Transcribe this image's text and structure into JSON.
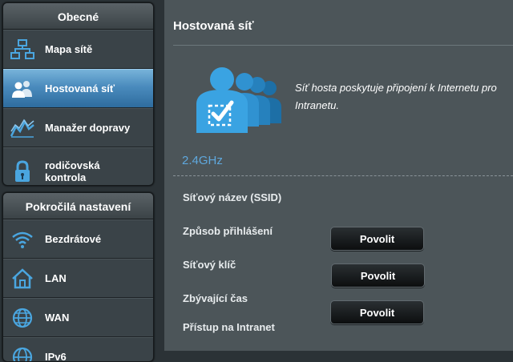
{
  "sidebar": {
    "general": {
      "header": "Obecné",
      "items": [
        {
          "label": "Mapa sítě",
          "icon": "network-map-icon"
        },
        {
          "label": "Hostovaná síť",
          "icon": "guest-network-icon",
          "active": true
        },
        {
          "label": "Manažer dopravy",
          "icon": "traffic-manager-icon"
        },
        {
          "label_line1": "rodičovská",
          "label_line2": "kontrola",
          "icon": "lock-icon"
        }
      ]
    },
    "advanced": {
      "header": "Pokročilá nastavení",
      "items": [
        {
          "label": "Bezdrátové",
          "icon": "wifi-icon"
        },
        {
          "label": "LAN",
          "icon": "home-icon"
        },
        {
          "label": "WAN",
          "icon": "globe-icon"
        },
        {
          "label": "IPv6",
          "icon": "globe-icon"
        }
      ]
    }
  },
  "main": {
    "title": "Hostovaná síť",
    "description_line1": "Síť hosta poskytuje připojení k Internetu pro",
    "description_line2": "Intranetu.",
    "band": "2.4GHz",
    "fields": {
      "ssid": "Síťový název (SSID)",
      "auth": "Způsob přihlášení",
      "key": "Síťový klíč",
      "time": "Zbývající čas",
      "intranet": "Přístup na Intranet"
    },
    "buttons": [
      "Povolit",
      "Povolit",
      "Povolit"
    ]
  },
  "colors": {
    "accent": "#4a8bbd",
    "band_label": "#5fa8dd",
    "background": "#4c5559"
  }
}
